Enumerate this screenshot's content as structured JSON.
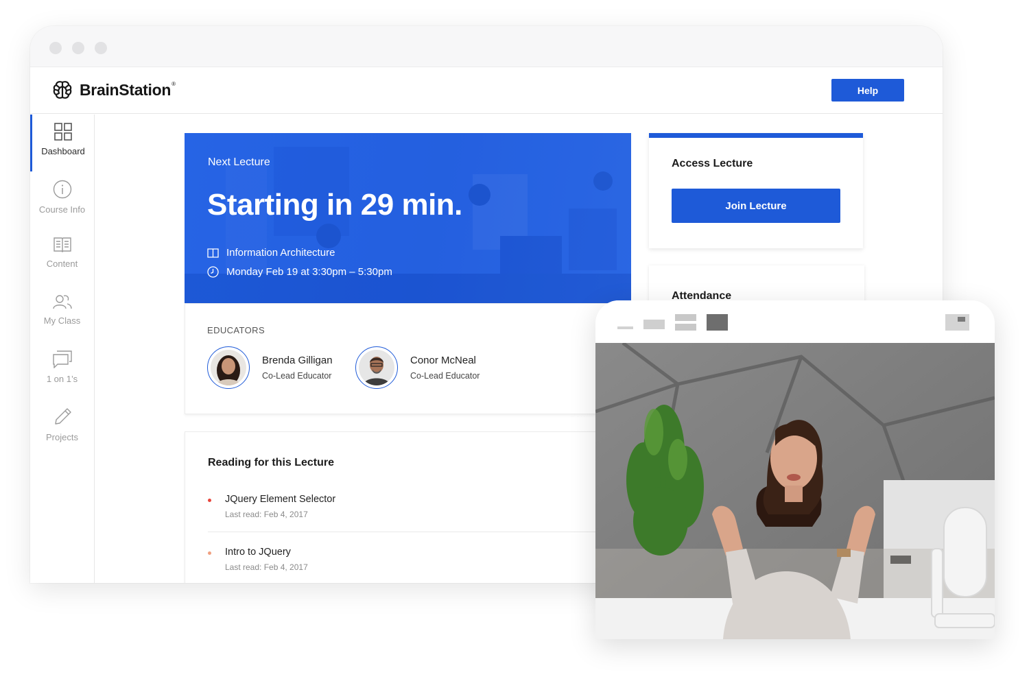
{
  "brand": {
    "name": "BrainStation",
    "mark": "®"
  },
  "header": {
    "help_label": "Help"
  },
  "sidebar": {
    "items": [
      {
        "label": "Dashboard",
        "icon": "grid-icon",
        "active": true
      },
      {
        "label": "Course Info",
        "icon": "info-icon",
        "active": false
      },
      {
        "label": "Content",
        "icon": "book-icon",
        "active": false
      },
      {
        "label": "My Class",
        "icon": "users-icon",
        "active": false
      },
      {
        "label": "1 on 1’s",
        "icon": "chat-icon",
        "active": false
      },
      {
        "label": "Projects",
        "icon": "pencil-icon",
        "active": false
      }
    ]
  },
  "lecture": {
    "kicker": "Next Lecture",
    "headline": "Starting in 29 min.",
    "course": "Information Architecture",
    "schedule": "Monday Feb 19 at 3:30pm – 5:30pm"
  },
  "educators": {
    "heading": "EDUCATORS",
    "people": [
      {
        "name": "Brenda Gilligan",
        "role": "Co-Lead Educator"
      },
      {
        "name": "Conor McNeal",
        "role": "Co-Lead Educator"
      }
    ]
  },
  "reading": {
    "title": "Reading for this Lecture",
    "items": [
      {
        "name": "JQuery Element Selector",
        "meta": "Last read: Feb 4, 2017",
        "bullet_color": "#e8453c"
      },
      {
        "name": "Intro to JQuery",
        "meta": "Last read: Feb 4, 2017",
        "bullet_color": "#f0a080"
      }
    ]
  },
  "access": {
    "title": "Access Lecture",
    "button_label": "Join Lecture"
  },
  "attendance": {
    "title": "Attendance"
  },
  "colors": {
    "accent": "#1e5ad8",
    "hero": "#1f5ee2"
  }
}
